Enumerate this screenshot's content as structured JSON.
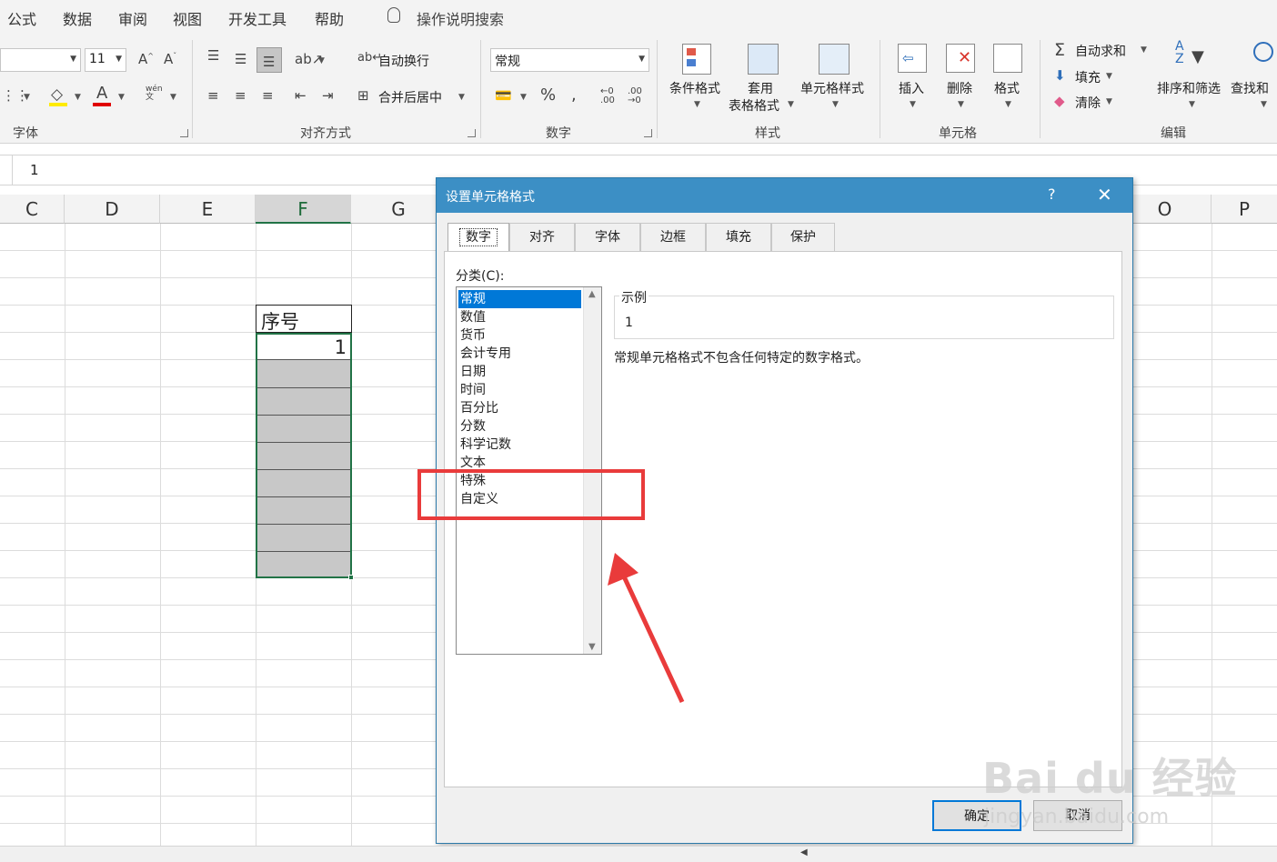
{
  "menu": {
    "tabs": [
      "公式",
      "数据",
      "审阅",
      "视图",
      "开发工具",
      "帮助"
    ],
    "tell_me": "操作说明搜索"
  },
  "ribbon": {
    "font": {
      "size": "11",
      "label": "字体",
      "phonetic": "wén"
    },
    "alignment": {
      "wrap_text": "自动换行",
      "merge_center": "合并后居中",
      "label": "对齐方式"
    },
    "number": {
      "format_value": "常规",
      "label": "数字"
    },
    "styles": {
      "conditional": "条件格式",
      "table_line1": "套用",
      "table_line2": "表格格式",
      "cell_styles": "单元格样式",
      "label": "样式"
    },
    "cells": {
      "insert": "插入",
      "delete": "删除",
      "format": "格式",
      "label": "单元格"
    },
    "editing": {
      "autosum": "自动求和",
      "fill": "填充",
      "clear": "清除",
      "sort_filter": "排序和筛选",
      "find_select": "查找和",
      "label": "编辑"
    }
  },
  "formula_bar": {
    "value": "1"
  },
  "columns": [
    "C",
    "D",
    "E",
    "F",
    "G",
    "O",
    "P"
  ],
  "sheet": {
    "header_cell": "序号",
    "value_cell": "1"
  },
  "dialog": {
    "title": "设置单元格格式",
    "help": "?",
    "close": "✕",
    "tabs": [
      "数字",
      "对齐",
      "字体",
      "边框",
      "填充",
      "保护"
    ],
    "category_label": "分类(C):",
    "categories": [
      "常规",
      "数值",
      "货币",
      "会计专用",
      "日期",
      "时间",
      "百分比",
      "分数",
      "科学记数",
      "文本",
      "特殊",
      "自定义"
    ],
    "sample_label": "示例",
    "sample_value": "1",
    "description": "常规单元格格式不包含任何特定的数字格式。",
    "ok": "确定",
    "cancel": "取消"
  },
  "watermark": {
    "brand": "Bai du 经验",
    "url": "jingyan.baidu.com"
  },
  "colors": {
    "dialog_title_bar": "#3c8fc5",
    "selection": "#0078d7",
    "annotation_red": "#e93b3b",
    "excel_green": "#217346"
  }
}
